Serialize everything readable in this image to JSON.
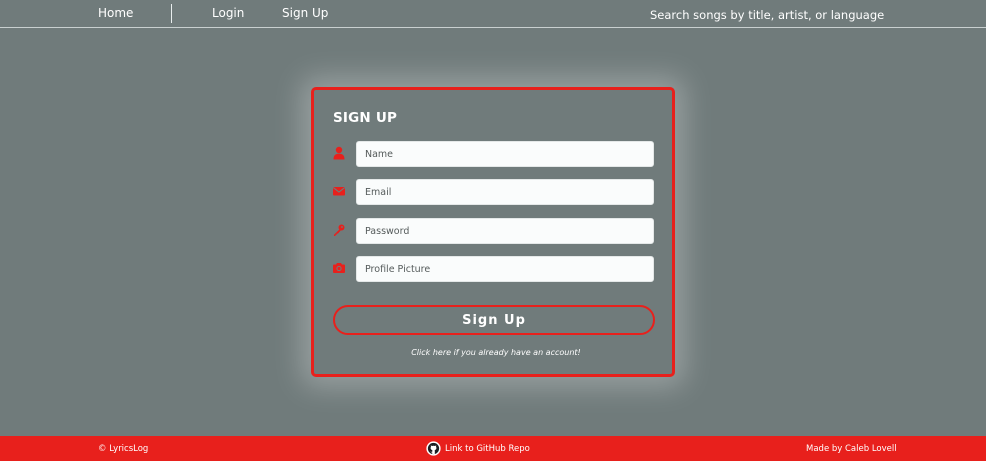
{
  "nav": {
    "home_label": "Home",
    "login_label": "Login",
    "signup_label": "Sign Up",
    "search_placeholder": "Search songs by title, artist, or language"
  },
  "form": {
    "title": "SIGN UP",
    "fields": [
      {
        "icon": "user-icon",
        "placeholder": "Name",
        "value": ""
      },
      {
        "icon": "envelope-icon",
        "placeholder": "Email",
        "value": ""
      },
      {
        "icon": "key-icon",
        "placeholder": "Password",
        "value": ""
      },
      {
        "icon": "camera-icon",
        "placeholder": "Profile Picture",
        "value": ""
      }
    ],
    "submit_label": "Sign Up",
    "login_link": "Click here if you already have an account!"
  },
  "footer": {
    "copyright": "© LyricsLog",
    "github_icon": "github-icon",
    "github_link": "Link to GitHub Repo",
    "credit": "Made by Caleb Lovell"
  },
  "colors": {
    "background": "#707b7b",
    "accent": "#e8201c",
    "text": "#ffffff"
  }
}
